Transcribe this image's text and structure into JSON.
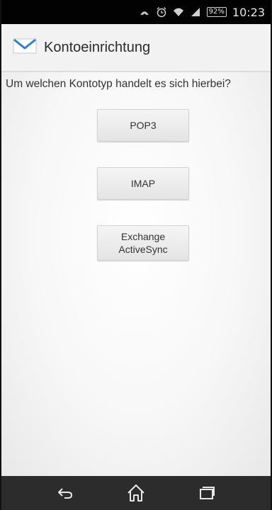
{
  "status_bar": {
    "battery": "92%",
    "time": "10:23"
  },
  "action_bar": {
    "title": "Kontoeinrichtung",
    "icon": "mail-envelope-icon"
  },
  "content": {
    "question": "Um welchen Kontotyp handelt es sich hierbei?",
    "buttons": {
      "pop3": "POP3",
      "imap": "IMAP",
      "exchange_line1": "Exchange",
      "exchange_line2": "ActiveSync"
    }
  },
  "nav_bar": {
    "back_icon": "back-icon",
    "home_icon": "home-icon",
    "recents_icon": "recents-icon"
  },
  "colors": {
    "status_bar": "#020202",
    "action_bar": "#f2f2f2",
    "nav_bar": "#2c2c2c",
    "envelope_blue": "#2f80c8"
  }
}
